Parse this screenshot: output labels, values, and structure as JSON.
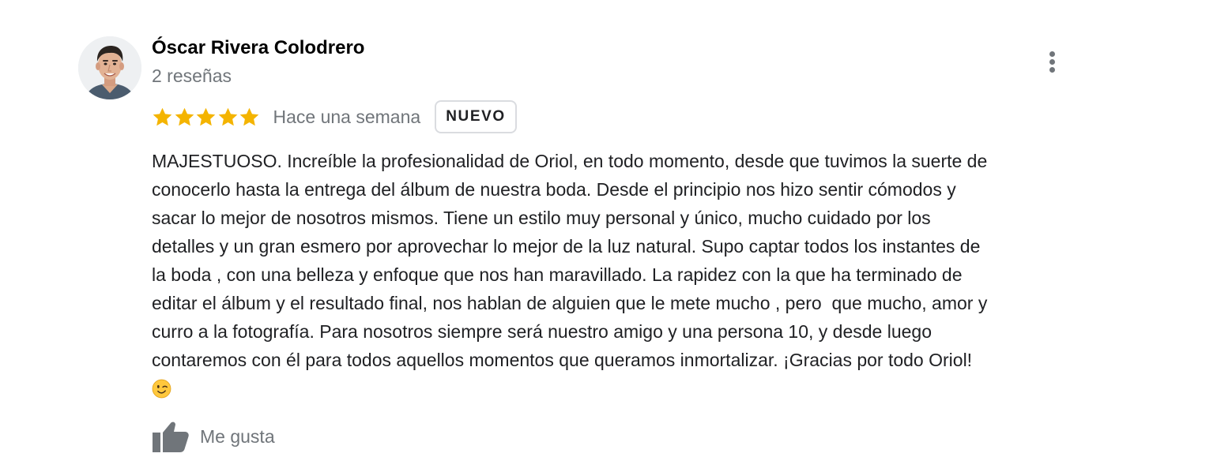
{
  "review": {
    "author": {
      "name": "Óscar Rivera Colodrero",
      "meta": "2 reseñas"
    },
    "rating": {
      "value": 5,
      "max": 5,
      "star_color": "#f4b400"
    },
    "time_ago": "Hace una semana",
    "badge": "NUEVO",
    "text_lines": [
      "MAJESTUOSO. Increíble la profesionalidad de Oriol, en todo momento, desde que tuvimos la suerte de",
      "conocerlo hasta la entrega del álbum de nuestra boda. Desde el principio nos hizo sentir cómodos y",
      "sacar lo mejor de nosotros mismos. Tiene un estilo muy personal y único, mucho cuidado por los",
      "detalles y un gran esmero por aprovechar lo mejor de la luz natural. Supo captar todos los instantes de",
      "la boda , con una belleza y enfoque que nos han maravillado. La rapidez con la que ha terminado de",
      "editar el álbum y el resultado final, nos hablan de alguien que le mete mucho , pero  que mucho, amor y",
      "curro a la fotografía. Para nosotros siempre será nuestro amigo y una persona 10, y desde luego",
      "contaremos con él para todos aquellos momentos que queramos inmortalizar. ¡Gracias por todo Oriol!"
    ],
    "emoji": "winking-face",
    "like_label": "Me gusta"
  },
  "icons": {
    "more": "more-vert-icon",
    "like": "thumb-up-icon",
    "star": "star-icon",
    "avatar": "profile-photo"
  },
  "colors": {
    "text": "#202124",
    "secondary_text": "#70757a",
    "badge_border": "#dadce0"
  }
}
